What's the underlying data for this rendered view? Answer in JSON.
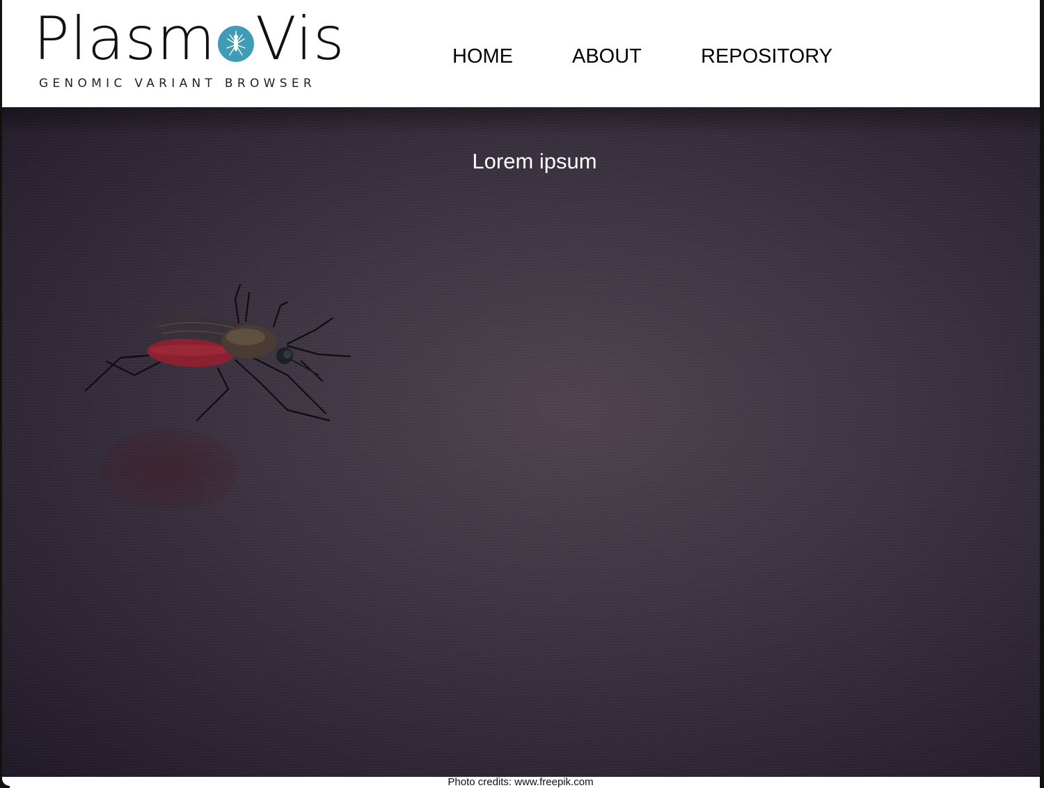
{
  "brand": {
    "name_left": "Plasm",
    "name_right": "Vis",
    "tagline": "GENOMIC VARIANT BROWSER",
    "accent_color": "#3e9cb7",
    "logo_icon": "mosquito-icon"
  },
  "nav": {
    "items": [
      {
        "label": "HOME"
      },
      {
        "label": "ABOUT"
      },
      {
        "label": "REPOSITORY"
      }
    ]
  },
  "hero": {
    "title": "Lorem ipsum",
    "image_subject": "mosquito-on-skin"
  },
  "footer": {
    "credits": "Photo credits: www.freepik.com"
  }
}
